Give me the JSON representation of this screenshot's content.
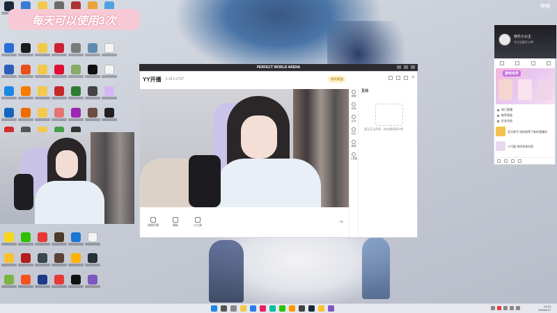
{
  "promo": {
    "text": "每天可以使用3次"
  },
  "watermark": {
    "text": "哔哩"
  },
  "topbar": {
    "title": "PERFECT WORLD ARENA"
  },
  "yy": {
    "logo": "YY开播",
    "version": "3.18.5.2737",
    "member_label": "会员权益",
    "toolbar": [
      {
        "label": "快捷开播"
      },
      {
        "label": "模板"
      },
      {
        "label": "小工具"
      }
    ],
    "toolbar_right": "□▸",
    "sidebar": [
      {
        "label": "直播"
      },
      {
        "label": "特效"
      },
      {
        "label": "互动"
      },
      {
        "label": "玩法"
      },
      {
        "label": "管理"
      },
      {
        "label": "工具箱"
      }
    ],
    "panel_title": "互动",
    "panel_empty": "暂无互动消息，快去邀请观众吧"
  },
  "qq": {
    "name": "快乐小公主",
    "signature": "今天也要开心鸭",
    "banner_title": "游戏世界",
    "list": [
      "热门直播",
      "推荐频道",
      "好友动态"
    ],
    "messages": [
      {
        "text": "官方助手 给你推荐了新的直播间"
      },
      {
        "text": "小可爱 给你发来消息"
      }
    ]
  },
  "taskbar": {
    "time": "14:24",
    "date": "2024/4/17"
  }
}
